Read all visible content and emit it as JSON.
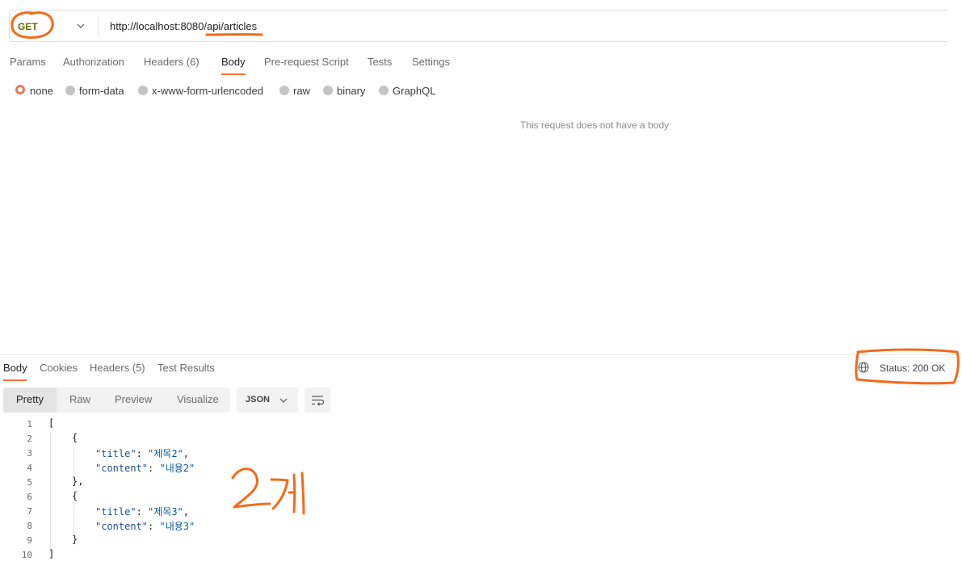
{
  "request": {
    "method": "GET",
    "url": "http://localhost:8080/api/articles",
    "tabs": [
      {
        "label": "Params"
      },
      {
        "label": "Authorization"
      },
      {
        "label": "Headers (6)"
      },
      {
        "label": "Body"
      },
      {
        "label": "Pre-request Script"
      },
      {
        "label": "Tests"
      },
      {
        "label": "Settings"
      }
    ],
    "active_tab": "Body",
    "body_types": [
      {
        "label": "none",
        "selected": true
      },
      {
        "label": "form-data"
      },
      {
        "label": "x-www-form-urlencoded"
      },
      {
        "label": "raw"
      },
      {
        "label": "binary"
      },
      {
        "label": "GraphQL"
      }
    ],
    "empty_body_message": "This request does not have a body"
  },
  "response": {
    "tabs": [
      {
        "label": "Body"
      },
      {
        "label": "Cookies"
      },
      {
        "label": "Headers (5)"
      },
      {
        "label": "Test Results"
      }
    ],
    "active_tab": "Body",
    "status": "Status: 200 OK",
    "view_modes": [
      {
        "label": "Pretty"
      },
      {
        "label": "Raw"
      },
      {
        "label": "Preview"
      },
      {
        "label": "Visualize"
      }
    ],
    "active_view": "Pretty",
    "format": "JSON",
    "lines": [
      {
        "n": "1",
        "open": "[",
        "close": ""
      },
      {
        "n": "2",
        "open": "{",
        "close": ""
      },
      {
        "n": "3",
        "key": "\"title\"",
        "sep": ": ",
        "val": "\"제목2\"",
        "end": ","
      },
      {
        "n": "4",
        "key": "\"content\"",
        "sep": ": ",
        "val": "\"내용2\"",
        "end": ""
      },
      {
        "n": "5",
        "open": "},",
        "close": ""
      },
      {
        "n": "6",
        "open": "{",
        "close": ""
      },
      {
        "n": "7",
        "key": "\"title\"",
        "sep": ": ",
        "val": "\"제목3\"",
        "end": ","
      },
      {
        "n": "8",
        "key": "\"content\"",
        "sep": ": ",
        "val": "\"내용3\"",
        "end": ""
      },
      {
        "n": "9",
        "open": "}",
        "close": ""
      },
      {
        "n": "10",
        "open": "]",
        "close": ""
      }
    ]
  },
  "annotation": {
    "handwritten_note": "2개",
    "color": "#f26a1b"
  },
  "colors": {
    "accent": "#ff6c37",
    "method_get": "#6a6a00"
  }
}
